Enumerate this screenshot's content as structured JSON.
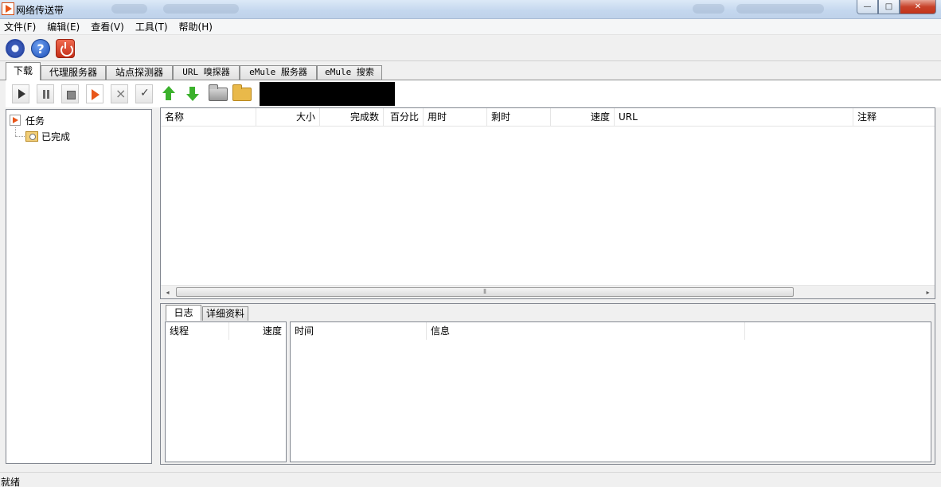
{
  "window": {
    "title": "网络传送带"
  },
  "menu": [
    "文件(F)",
    "编辑(E)",
    "查看(V)",
    "工具(T)",
    "帮助(H)"
  ],
  "top_toolbar": {
    "icons": [
      "gear-icon",
      "help-icon",
      "power-icon"
    ],
    "help_glyph": "?"
  },
  "main_tabs": [
    "下载",
    "代理服务器",
    "站点探测器",
    "URL 嗅探器",
    "eMule 服务器",
    "eMule 搜索"
  ],
  "download_toolbar": {
    "icons": [
      "play-icon",
      "pause-icon",
      "stop-icon",
      "start-all-icon",
      "remove-icon",
      "mark-complete-icon",
      "move-up-icon",
      "move-down-icon",
      "open-folder-icon",
      "folder-icon"
    ]
  },
  "tree": {
    "root": "任务",
    "children": [
      "已完成"
    ]
  },
  "download_list": {
    "columns": [
      "名称",
      "大小",
      "完成数",
      "百分比",
      "用时",
      "剩时",
      "速度",
      "URL",
      "注释"
    ],
    "rows": []
  },
  "scrollbar": {
    "left": "◂",
    "right": "▸",
    "grip": "⦀"
  },
  "lower_tabs": [
    "日志",
    "详细资料"
  ],
  "threads_list": {
    "columns": [
      "线程",
      "速度"
    ]
  },
  "log_list": {
    "columns": [
      "时间",
      "信息",
      ""
    ]
  },
  "status": "就绪",
  "colors": {
    "accent_orange": "#e8561a",
    "arrow_green": "#3bb12c",
    "close_red": "#c8432b"
  }
}
